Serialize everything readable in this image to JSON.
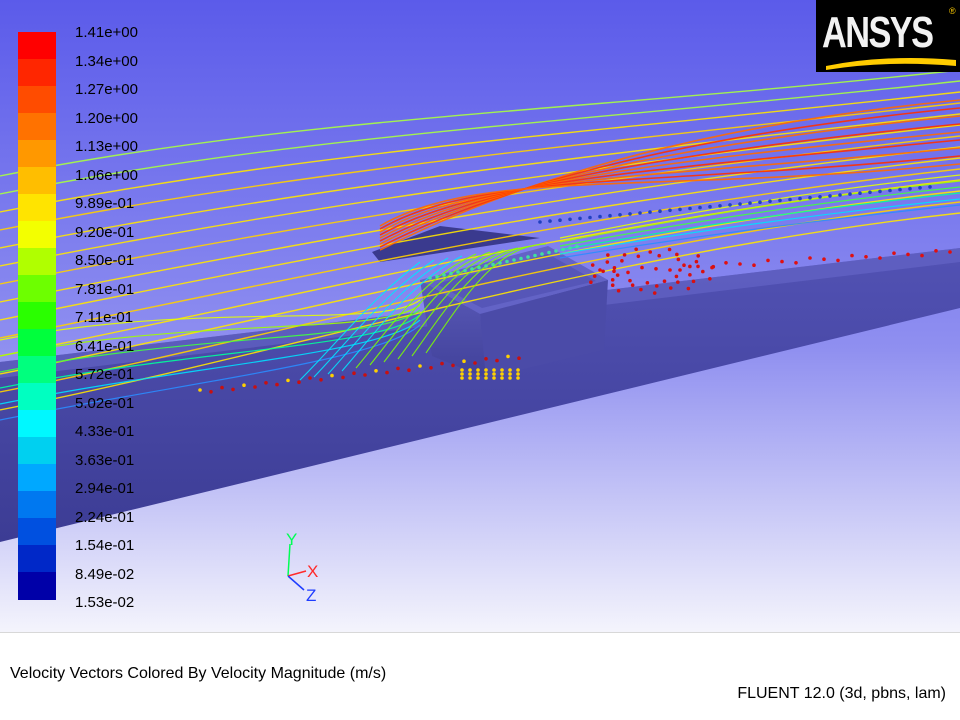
{
  "colormap": {
    "labels": [
      "1.41e+00",
      "1.34e+00",
      "1.27e+00",
      "1.20e+00",
      "1.13e+00",
      "1.06e+00",
      "9.89e-01",
      "9.20e-01",
      "8.50e-01",
      "7.81e-01",
      "7.11e-01",
      "6.41e-01",
      "5.72e-01",
      "5.02e-01",
      "4.33e-01",
      "3.63e-01",
      "2.94e-01",
      "2.24e-01",
      "1.54e-01",
      "8.49e-02",
      "1.53e-02"
    ],
    "colors": [
      "#ff0000",
      "#ff2600",
      "#ff4c00",
      "#ff7200",
      "#ff9800",
      "#ffbe00",
      "#ffe400",
      "#f3ff00",
      "#b0ff00",
      "#6dff00",
      "#2aff00",
      "#00ff3c",
      "#00ff7e",
      "#00ffc1",
      "#00f8ff",
      "#00d0f0",
      "#00a8ff",
      "#0078f0",
      "#0050e0",
      "#0028c8",
      "#0000a8"
    ]
  },
  "logo": {
    "text": "ANSYS",
    "reg": "®"
  },
  "triad": {
    "y": "Y",
    "x": "X",
    "z": "Z"
  },
  "footer": {
    "caption": "Velocity Vectors Colored By Velocity Magnitude (m/s)",
    "solver": "FLUENT 12.0 (3d, pbns, lam)"
  }
}
